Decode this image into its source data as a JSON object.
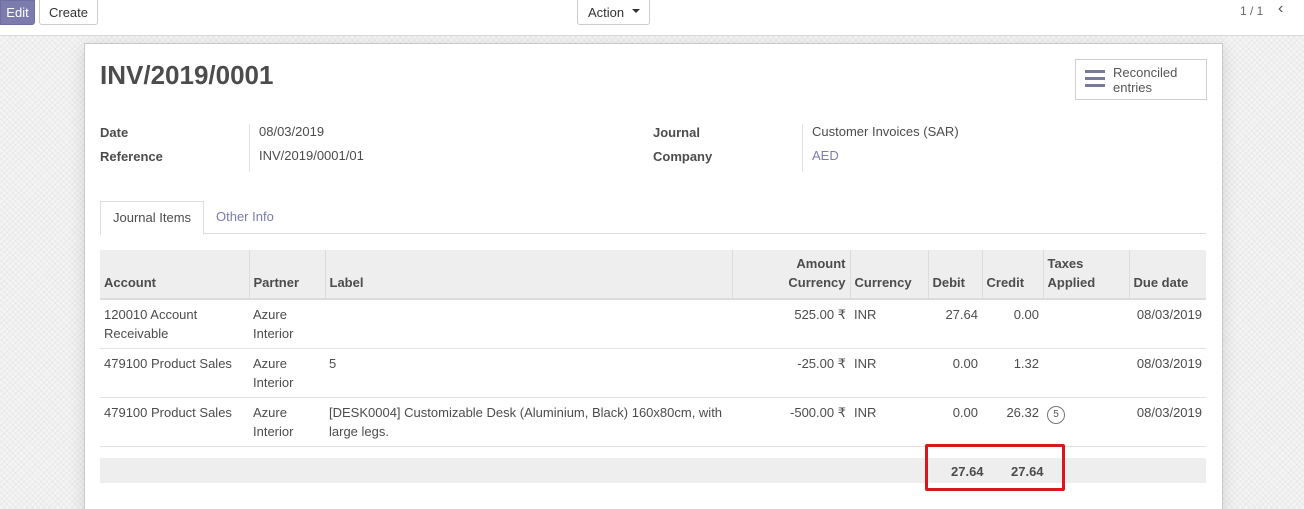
{
  "control_panel": {
    "edit_label": "Edit",
    "create_label": "Create",
    "action_label": "Action",
    "pager": "1 / 1",
    "prev_icon": "chevron-left-icon"
  },
  "record": {
    "title": "INV/2019/0001",
    "smart_button": {
      "label": "Reconciled entries",
      "icon": "bars-icon"
    },
    "fields": {
      "date_label": "Date",
      "date_value": "08/03/2019",
      "reference_label": "Reference",
      "reference_value": "INV/2019/0001/01",
      "journal_label": "Journal",
      "journal_value": "Customer Invoices (SAR)",
      "company_label": "Company",
      "company_value": "AED"
    }
  },
  "tabs": [
    {
      "label": "Journal Items",
      "active": true
    },
    {
      "label": "Other Info",
      "active": false
    }
  ],
  "table": {
    "columns": {
      "account": "Account",
      "partner": "Partner",
      "label": "Label",
      "amount_currency": "Amount Currency",
      "currency": "Currency",
      "debit": "Debit",
      "credit": "Credit",
      "taxes_applied": "Taxes Applied",
      "due_date": "Due date"
    },
    "rows": [
      {
        "account": "120010 Account Receivable",
        "partner": "Azure Interior",
        "label": "",
        "amount_currency": "525.00 ₹",
        "currency": "INR",
        "debit": "27.64",
        "credit": "0.00",
        "taxes": "",
        "due_date": "08/03/2019"
      },
      {
        "account": "479100 Product Sales",
        "partner": "Azure Interior",
        "label": "5",
        "amount_currency": "-25.00 ₹",
        "currency": "INR",
        "debit": "0.00",
        "credit": "1.32",
        "taxes": "",
        "due_date": "08/03/2019"
      },
      {
        "account": "479100 Product Sales",
        "partner": "Azure Interior",
        "label": "[DESK0004] Customizable Desk (Aluminium, Black) 160x80cm, with large legs.",
        "amount_currency": "-500.00 ₹",
        "currency": "INR",
        "debit": "0.00",
        "credit": "26.32",
        "taxes": "5",
        "due_date": "08/03/2019"
      }
    ],
    "totals": {
      "debit": "27.64",
      "credit": "27.64"
    }
  },
  "colors": {
    "primary": "#7c7bad",
    "highlight": "#d7191c"
  }
}
